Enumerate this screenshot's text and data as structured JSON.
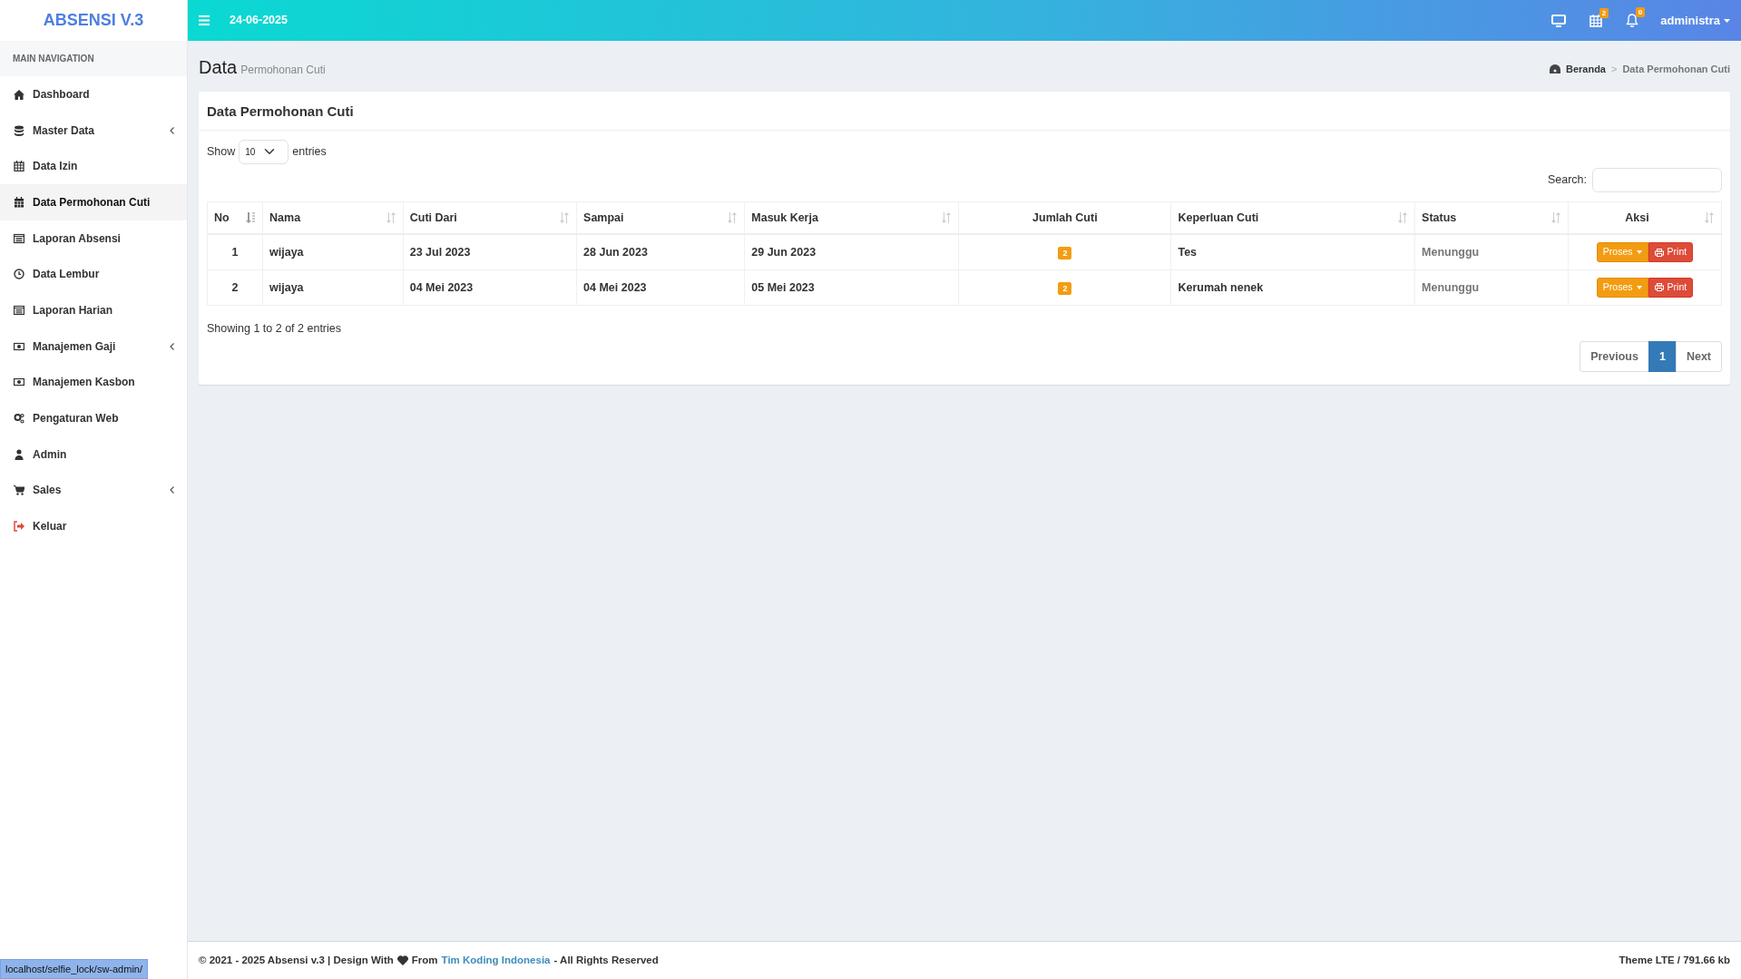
{
  "brand": "ABSENSI V.3",
  "header": {
    "date": "24-06-2025",
    "calendar_badge": "2",
    "bell_badge": "0",
    "user": "administra"
  },
  "sidebar": {
    "heading": "MAIN NAVIGATION",
    "items": [
      {
        "label": "Dashboard",
        "selected": false,
        "has_submenu": false
      },
      {
        "label": "Master Data",
        "selected": false,
        "has_submenu": true
      },
      {
        "label": "Data Izin",
        "selected": false,
        "has_submenu": false
      },
      {
        "label": "Data Permohonan Cuti",
        "selected": true,
        "has_submenu": false
      },
      {
        "label": "Laporan Absensi",
        "selected": false,
        "has_submenu": false
      },
      {
        "label": "Data Lembur",
        "selected": false,
        "has_submenu": false
      },
      {
        "label": "Laporan Harian",
        "selected": false,
        "has_submenu": false
      },
      {
        "label": "Manajemen Gaji",
        "selected": false,
        "has_submenu": true
      },
      {
        "label": "Manajemen Kasbon",
        "selected": false,
        "has_submenu": false
      },
      {
        "label": "Pengaturan Web",
        "selected": false,
        "has_submenu": false
      },
      {
        "label": "Admin",
        "selected": false,
        "has_submenu": false
      },
      {
        "label": "Sales",
        "selected": false,
        "has_submenu": true
      },
      {
        "label": "Keluar",
        "selected": false,
        "has_submenu": false
      }
    ]
  },
  "page": {
    "title": "Data",
    "subtitle": "Permohonan Cuti",
    "breadcrumb": [
      "Beranda",
      "Data Permohonan Cuti"
    ],
    "breadcrumb_separator": ">"
  },
  "card": {
    "title": "Data Permohonan Cuti",
    "show_label": "Show",
    "entries_value": "10",
    "entries_label": "entries",
    "search_label": "Search:",
    "table": {
      "columns": [
        {
          "label": "No",
          "sortable": true,
          "sorted": true
        },
        {
          "label": "Nama",
          "sortable": true,
          "sorted": false
        },
        {
          "label": "Cuti Dari",
          "sortable": true,
          "sorted": false
        },
        {
          "label": "Sampai",
          "sortable": true,
          "sorted": false
        },
        {
          "label": "Masuk Kerja",
          "sortable": true,
          "sorted": false
        },
        {
          "label": "Jumlah Cuti",
          "sortable": false
        },
        {
          "label": "Keperluan Cuti",
          "sortable": true,
          "sorted": false
        },
        {
          "label": "Status",
          "sortable": true,
          "sorted": false
        },
        {
          "label": "Aksi",
          "sortable": true,
          "sorted": false
        }
      ],
      "rows": [
        {
          "no": "1",
          "nama": "wijaya",
          "cuti_dari": "23 Jul 2023",
          "sampai": "28 Jun 2023",
          "masuk_kerja": "29 Jun 2023",
          "jumlah_cuti": "2",
          "keperluan": "Tes",
          "status": "Menunggu",
          "actions": [
            "Proses",
            "Print"
          ]
        },
        {
          "no": "2",
          "nama": "wijaya",
          "cuti_dari": "04 Mei 2023",
          "sampai": "04 Mei 2023",
          "masuk_kerja": "05 Mei 2023",
          "jumlah_cuti": "2",
          "keperluan": "Kerumah nenek",
          "status": "Menunggu",
          "actions": [
            "Proses",
            "Print"
          ]
        }
      ]
    },
    "info": "Showing 1 to 2 of 2 entries",
    "pagination": [
      {
        "label": "Previous",
        "selected": false
      },
      {
        "label": "1",
        "selected": true
      },
      {
        "label": "Next",
        "selected": false
      }
    ]
  },
  "footer": {
    "before_heart": "© 2021 - 2025 Absensi v.3 | Design With",
    "after_heart": "From",
    "link": "Tim Koding Indonesia",
    "after_link": "- All Rights Reserved",
    "right": "Theme LTE / 791.66 kb"
  },
  "status_bar": {
    "url": "localhost/selfie_lock/sw-admin/"
  }
}
